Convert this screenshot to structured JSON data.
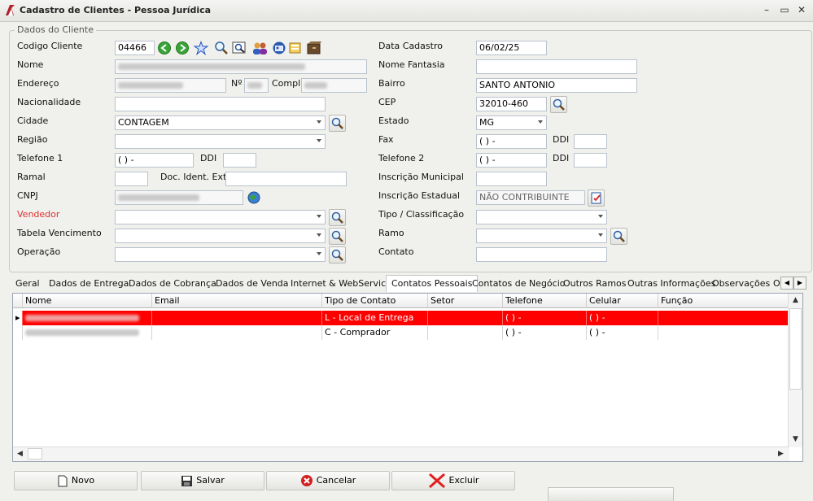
{
  "window": {
    "title": "Cadastro de Clientes - Pessoa Jurídica"
  },
  "group": {
    "label": "Dados do Cliente"
  },
  "labels": {
    "codigo": "Codigo Cliente",
    "nome": "Nome",
    "endereco": "Endereço",
    "numero": "Nº",
    "compl": "Compl.",
    "nacionalidade": "Nacionalidade",
    "cidade": "Cidade",
    "regiao": "Região",
    "telefone1": "Telefone 1",
    "ddi1": "DDI",
    "ramal": "Ramal",
    "docident": "Doc. Ident. Ext.",
    "cnpj": "CNPJ",
    "vendedor": "Vendedor",
    "tabela": "Tabela Vencimento",
    "operacao": "Operação",
    "data_cadastro": "Data Cadastro",
    "nome_fantasia": "Nome Fantasia",
    "bairro": "Bairro",
    "cep": "CEP",
    "estado": "Estado",
    "fax": "Fax",
    "ddi_fax": "DDI",
    "telefone2": "Telefone 2",
    "ddi2": "DDI",
    "insc_municipal": "Inscrição Municipal",
    "insc_estadual": "Inscrição Estadual",
    "tipo": "Tipo / Classificação",
    "ramo": "Ramo",
    "contato": "Contato"
  },
  "values": {
    "codigo": "04466",
    "cidade": "CONTAGEM",
    "telefone1": "( )   -",
    "data_cadastro": "06/02/25",
    "bairro": "SANTO ANTONIO",
    "cep": "32010-460",
    "estado": "MG",
    "fax": "( )   -",
    "telefone2": "( )   -",
    "insc_estadual": "NÃO CONTRIBUINTE"
  },
  "tabs": [
    {
      "label": "Geral"
    },
    {
      "label": "Dados de Entrega"
    },
    {
      "label": "Dados de Cobrança"
    },
    {
      "label": "Dados de Venda"
    },
    {
      "label": "Internet & WebServices"
    },
    {
      "label": "Contatos Pessoais"
    },
    {
      "label": "Contatos de Negócio"
    },
    {
      "label": "Outros Ramos"
    },
    {
      "label": "Outras Informações"
    },
    {
      "label": "Observações"
    },
    {
      "label": "O"
    }
  ],
  "grid": {
    "columns": [
      "Nome",
      "Email",
      "Tipo de Contato",
      "Setor",
      "Telefone",
      "Celular",
      "Função"
    ],
    "rows": [
      {
        "tipo": "L - Local de Entrega",
        "telefone": "( )   -",
        "celular": "( )   -"
      },
      {
        "tipo": "C - Comprador",
        "telefone": "( )   -",
        "celular": "( )   -"
      }
    ]
  },
  "buttons": {
    "novo": "Novo",
    "salvar": "Salvar",
    "cancelar": "Cancelar",
    "excluir": "Excluir"
  },
  "colors": {
    "selected_row": "#ff0000",
    "vendedor_label": "#e03030"
  }
}
